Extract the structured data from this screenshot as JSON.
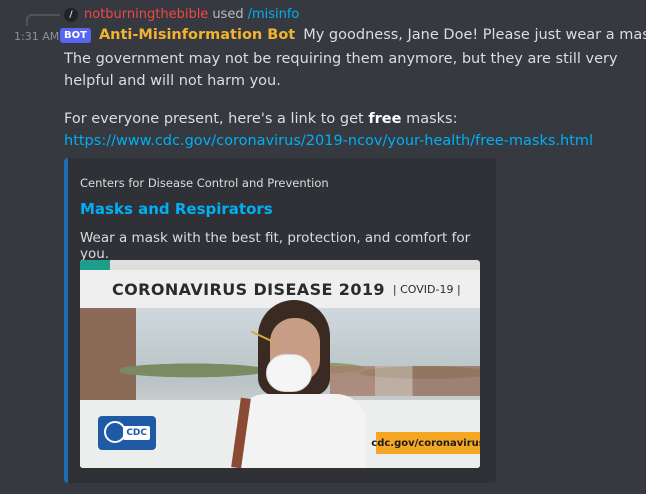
{
  "reply": {
    "command_icon_glyph": "/",
    "user": "notburningthebible",
    "used": "used",
    "command": "/misinfo"
  },
  "message": {
    "timestamp": "1:31 AM",
    "bot_tag": "BOT",
    "author": "Anti-Misinformation Bot",
    "author_color": "#f2b32e",
    "first_line": "My goodness, Jane Doe! Please just wear a mask.",
    "paragraph": "The government may not be requiring them anymore, but they are still very helpful and will not harm you.",
    "link_intro_before": "For everyone present, here's a link to get ",
    "link_intro_bold": "free",
    "link_intro_after": " masks:",
    "link": "https://www.cdc.gov/coronavirus/2019-ncov/your-health/free-masks.html"
  },
  "embed": {
    "accent_color": "#1a6fb7",
    "provider": "Centers for Disease Control and Prevention",
    "title": "Masks and Respirators",
    "description": "Wear a mask with the best fit, protection, and comfort for you.",
    "image": {
      "headline": "CORONAVIRUS DISEASE 2019",
      "subline": "| COVID-19 |",
      "logo_text": "CDC",
      "url_badge": "cdc.gov/coronavirus"
    }
  }
}
